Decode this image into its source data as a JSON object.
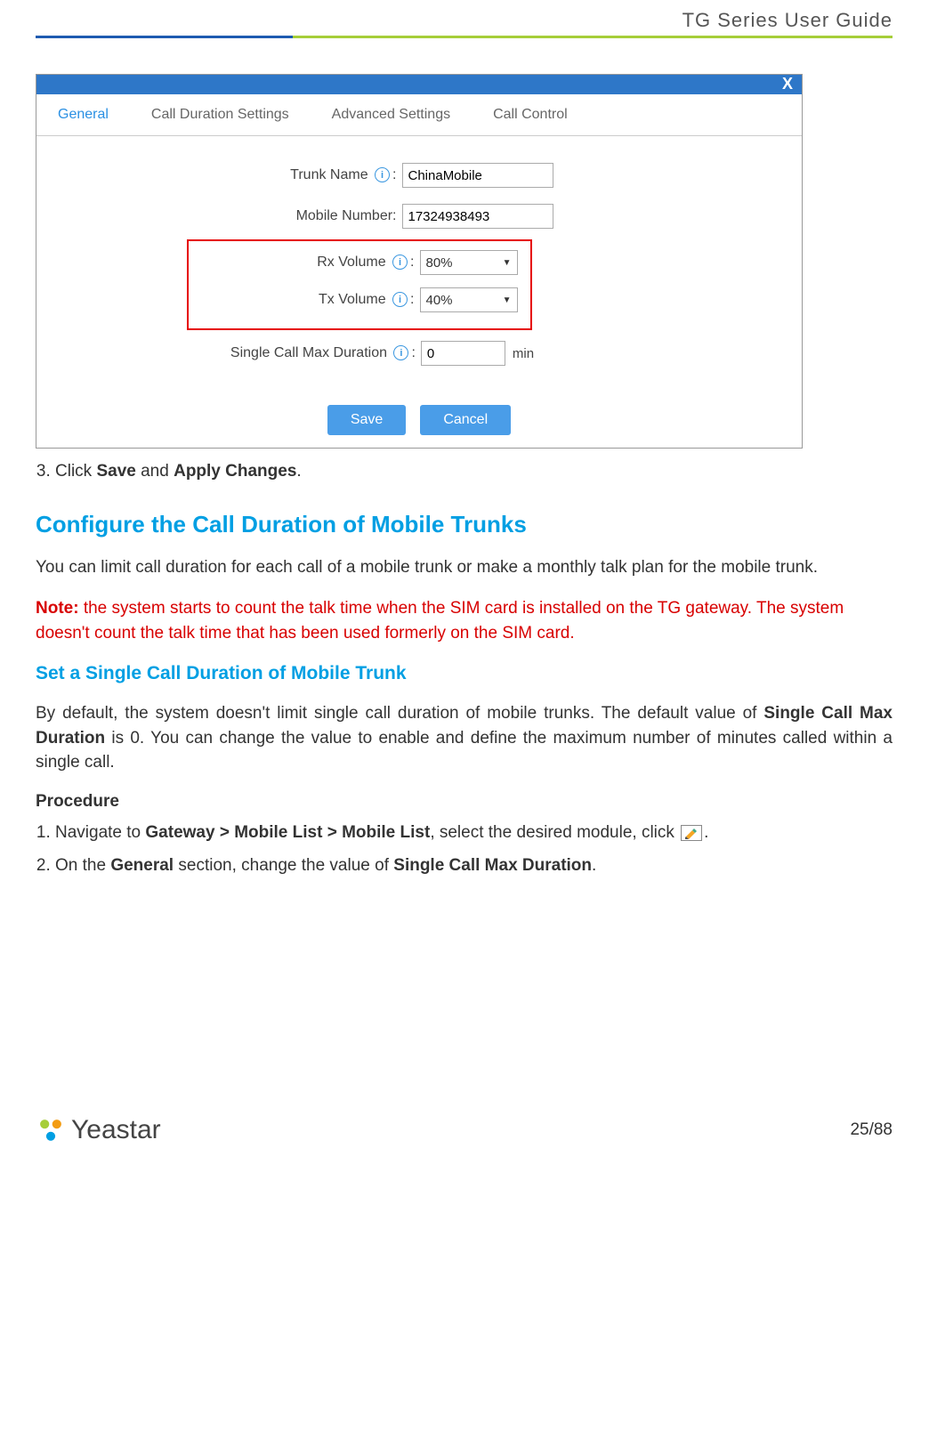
{
  "header": {
    "title": "TG  Series  User  Guide"
  },
  "screenshot": {
    "close": "X",
    "tabs": {
      "general": "General",
      "cds": "Call Duration Settings",
      "adv": "Advanced Settings",
      "cc": "Call Control"
    },
    "labels": {
      "trunk_name": "Trunk Name",
      "mobile_number": "Mobile Number:",
      "rx": "Rx Volume",
      "tx": "Tx Volume",
      "single_max": "Single Call Max Duration",
      "min": "min"
    },
    "values": {
      "trunk_name": "ChinaMobile",
      "mobile_number": "17324938493",
      "rx": "80%",
      "tx": "40%",
      "single_max": "0"
    },
    "buttons": {
      "save": "Save",
      "cancel": "Cancel"
    }
  },
  "doc": {
    "step3_pre": "Click ",
    "step3_b1": "Save",
    "step3_mid": " and ",
    "step3_b2": "Apply Changes",
    "step3_end": ".",
    "h2": "Configure the Call Duration of Mobile Trunks",
    "p1": "You can limit call duration for each call of a mobile trunk or make a monthly talk plan for the mobile trunk.",
    "note_label": "Note:",
    "note_text": " the system starts to count the talk time when the SIM card is installed on the TG gateway. The system doesn't count the talk time that has been used formerly on the SIM card.",
    "h3": "Set a Single Call Duration of Mobile Trunk",
    "p2a": "By default, the system doesn't limit single call duration of mobile trunks. The default value of ",
    "p2b": "Single Call Max Duration",
    "p2c": " is 0. You can change the value to enable and define the maximum number of minutes called within a single call.",
    "proc": "Procedure",
    "s1a": "Navigate to ",
    "s1b": "Gateway > Mobile List > Mobile List",
    "s1c": ", select the desired module, click ",
    "s1d": ".",
    "s2a": "On the ",
    "s2b": "General",
    "s2c": " section, change the value of ",
    "s2d": "Single Call Max Duration",
    "s2e": "."
  },
  "footer": {
    "brand": "Yeastar",
    "page": "25/88"
  }
}
